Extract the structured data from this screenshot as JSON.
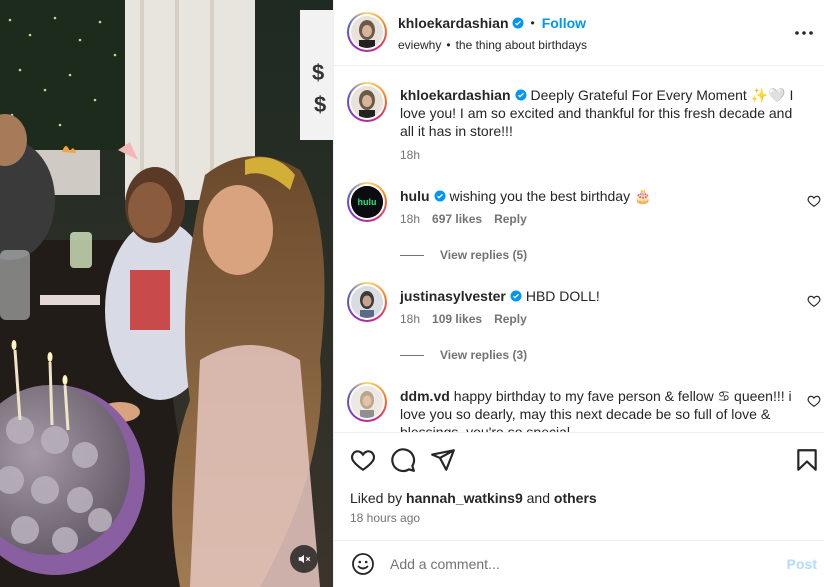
{
  "post": {
    "author": "khloekardashian",
    "follow_label": "Follow",
    "separator": "•",
    "audio_artist": "eviewhy",
    "audio_title": "the thing about birthdays"
  },
  "caption": {
    "username": "khloekardashian",
    "text": "Deeply Grateful For Every Moment ✨🤍 I love you! I am so excited and thankful for this fresh decade and all it has in store!!!",
    "time": "18h"
  },
  "comments": [
    {
      "username": "hulu",
      "text": "wishing you the best birthday 🎂",
      "time": "18h",
      "likes": "697 likes",
      "reply_label": "Reply",
      "view_replies": "View replies (5)"
    },
    {
      "username": "justinasylvester",
      "text": "HBD DOLL!",
      "time": "18h",
      "likes": "109 likes",
      "reply_label": "Reply",
      "view_replies": "View replies (3)"
    },
    {
      "username": "ddm.vd",
      "text": "happy birthday to my fave person & fellow ♋ queen!!! i love you so dearly, may this next decade be so full of love & blessings, you're so special"
    }
  ],
  "footer": {
    "liked_prefix": "Liked by",
    "liked_user": "hannah_watkins9",
    "liked_and": "and",
    "liked_others": "others",
    "timestamp": "18 hours ago",
    "comment_placeholder": "Add a comment...",
    "post_label": "Post"
  },
  "icons": [
    "more-options-icon",
    "verified-badge-icon",
    "heart-icon",
    "comment-icon",
    "share-icon",
    "bookmark-icon",
    "emoji-icon",
    "mute-icon"
  ],
  "colors": {
    "accent": "#0095f6",
    "verified": "#0095f6",
    "post_disabled": "#b3dbff",
    "muted_text": "#737373"
  }
}
